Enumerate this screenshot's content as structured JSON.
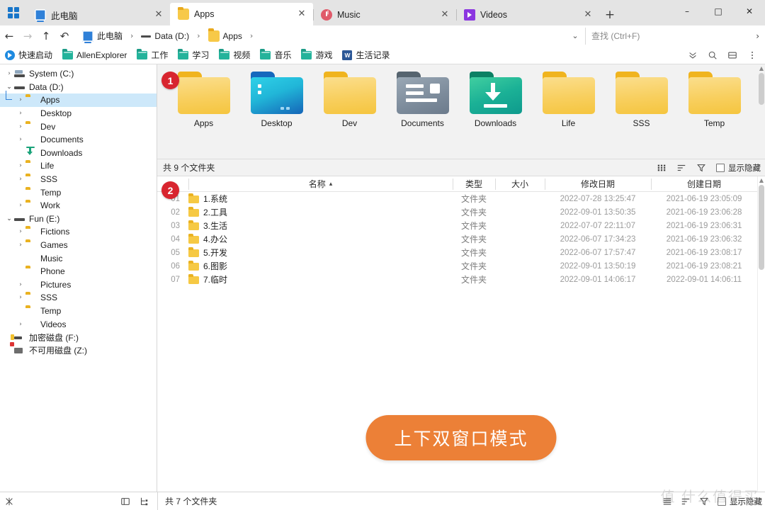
{
  "window": {
    "app_menu_icon": "grid-apps-icon",
    "minimize_label": "–",
    "maximize_label": "□",
    "close_label": "✕",
    "new_tab_label": "+"
  },
  "tabs": [
    {
      "label": "此电脑",
      "icon": "monitor-icon",
      "active": false,
      "close": "✕"
    },
    {
      "label": "Apps",
      "icon": "folder-icon",
      "active": true,
      "close": "✕"
    },
    {
      "label": "Music",
      "icon": "music-icon",
      "active": false,
      "close": "✕"
    },
    {
      "label": "Videos",
      "icon": "video-icon",
      "active": false,
      "close": "✕"
    }
  ],
  "address": {
    "back": "←",
    "forward": "→",
    "up": "↑",
    "undo": "↶",
    "crumbs": [
      {
        "label": "此电脑",
        "icon": "monitor-icon",
        "sep": "›"
      },
      {
        "label": "Data (D:)",
        "icon": "drive-icon",
        "sep": "›"
      },
      {
        "label": "Apps",
        "icon": "folder-icon",
        "sep": "›"
      }
    ],
    "dropdown": "⌄",
    "search_placeholder": "查找 (Ctrl+F)",
    "search_value": "",
    "search_arrow": "›"
  },
  "bookmarks": {
    "items": [
      {
        "label": "快速启动",
        "icon": "quick-launch-icon"
      },
      {
        "label": "AllenExplorer",
        "icon": "teal-folder-icon"
      },
      {
        "label": "工作",
        "icon": "teal-folder-icon"
      },
      {
        "label": "学习",
        "icon": "teal-folder-icon"
      },
      {
        "label": "视频",
        "icon": "teal-folder-icon"
      },
      {
        "label": "音乐",
        "icon": "teal-folder-icon"
      },
      {
        "label": "游戏",
        "icon": "teal-folder-icon"
      },
      {
        "label": "生活记录",
        "icon": "word-doc-icon"
      }
    ],
    "tools": [
      "chevrons-down-icon",
      "search-icon",
      "split-view-icon",
      "more-vertical-icon"
    ]
  },
  "sidebar": {
    "items": [
      {
        "label": "System (C:)",
        "icon": "drive-system-icon",
        "chev": "›",
        "indent": 0,
        "selected": false
      },
      {
        "label": "Data (D:)",
        "icon": "drive-icon",
        "chev": "⌄",
        "indent": 0,
        "selected": false
      },
      {
        "label": "Apps",
        "icon": "folder-icon",
        "chev": "›",
        "indent": 1,
        "selected": true
      },
      {
        "label": "Desktop",
        "icon": "desktop-icon",
        "chev": "›",
        "indent": 1,
        "selected": false
      },
      {
        "label": "Dev",
        "icon": "folder-icon",
        "chev": "›",
        "indent": 1,
        "selected": false
      },
      {
        "label": "Documents",
        "icon": "documents-icon",
        "chev": "›",
        "indent": 1,
        "selected": false
      },
      {
        "label": "Downloads",
        "icon": "downloads-icon",
        "chev": "",
        "indent": 1,
        "selected": false
      },
      {
        "label": "Life",
        "icon": "folder-icon",
        "chev": "›",
        "indent": 1,
        "selected": false
      },
      {
        "label": "SSS",
        "icon": "folder-icon",
        "chev": "›",
        "indent": 1,
        "selected": false
      },
      {
        "label": "Temp",
        "icon": "folder-icon",
        "chev": "",
        "indent": 1,
        "selected": false
      },
      {
        "label": "Work",
        "icon": "folder-icon",
        "chev": "›",
        "indent": 1,
        "selected": false
      },
      {
        "label": "Fun (E:)",
        "icon": "drive-icon",
        "chev": "⌄",
        "indent": 0,
        "selected": false
      },
      {
        "label": "Fictions",
        "icon": "folder-icon",
        "chev": "›",
        "indent": 1,
        "selected": false
      },
      {
        "label": "Games",
        "icon": "folder-icon",
        "chev": "›",
        "indent": 1,
        "selected": false
      },
      {
        "label": "Music",
        "icon": "music-icon",
        "chev": "",
        "indent": 1,
        "selected": false
      },
      {
        "label": "Phone",
        "icon": "folder-icon",
        "chev": "",
        "indent": 1,
        "selected": false
      },
      {
        "label": "Pictures",
        "icon": "pictures-icon",
        "chev": "›",
        "indent": 1,
        "selected": false
      },
      {
        "label": "SSS",
        "icon": "folder-icon",
        "chev": "›",
        "indent": 1,
        "selected": false
      },
      {
        "label": "Temp",
        "icon": "folder-icon",
        "chev": "",
        "indent": 1,
        "selected": false
      },
      {
        "label": "Videos",
        "icon": "video-icon",
        "chev": "›",
        "indent": 1,
        "selected": false
      },
      {
        "label": "加密磁盘 (F:)",
        "icon": "encrypted-drive-icon",
        "chev": "",
        "indent": 0,
        "selected": false
      },
      {
        "label": "不可用磁盘 (Z:)",
        "icon": "unavailable-drive-icon",
        "chev": "",
        "indent": 0,
        "selected": false
      }
    ]
  },
  "top_pane": {
    "badge": "1",
    "folders": [
      {
        "label": "Apps",
        "style": "yellow",
        "icon": "folder-icon"
      },
      {
        "label": "Desktop",
        "style": "blue",
        "icon": "desktop-folder-icon"
      },
      {
        "label": "Dev",
        "style": "yellow",
        "icon": "folder-icon"
      },
      {
        "label": "Documents",
        "style": "gray",
        "icon": "documents-folder-icon"
      },
      {
        "label": "Downloads",
        "style": "green",
        "icon": "downloads-folder-icon"
      },
      {
        "label": "Life",
        "style": "yellow",
        "icon": "folder-icon"
      },
      {
        "label": "SSS",
        "style": "yellow",
        "icon": "folder-icon"
      },
      {
        "label": "Temp",
        "style": "yellow",
        "icon": "folder-icon"
      }
    ],
    "status": "共 9 个文件夹",
    "tools": [
      "grid-view-icon",
      "sort-icon",
      "filter-icon"
    ],
    "show_hidden_label": "显示隐藏",
    "show_hidden_checked": false
  },
  "bottom_pane": {
    "badge": "2",
    "columns": {
      "index": "",
      "name": "名称",
      "name_sort": "▴",
      "type": "类型",
      "size": "大小",
      "modified": "修改日期",
      "created": "创建日期"
    },
    "rows": [
      {
        "idx": "01",
        "name": "1.系统",
        "type": "文件夹",
        "size": "",
        "modified": "2022-07-28  13:25:47",
        "created": "2021-06-19  23:05:09"
      },
      {
        "idx": "02",
        "name": "2.工具",
        "type": "文件夹",
        "size": "",
        "modified": "2022-09-01  13:50:35",
        "created": "2021-06-19  23:06:28"
      },
      {
        "idx": "03",
        "name": "3.生活",
        "type": "文件夹",
        "size": "",
        "modified": "2022-07-07  22:11:07",
        "created": "2021-06-19  23:06:31"
      },
      {
        "idx": "04",
        "name": "4.办公",
        "type": "文件夹",
        "size": "",
        "modified": "2022-06-07  17:34:23",
        "created": "2021-06-19  23:06:32"
      },
      {
        "idx": "05",
        "name": "5.开发",
        "type": "文件夹",
        "size": "",
        "modified": "2022-06-07  17:57:47",
        "created": "2021-06-19  23:08:17"
      },
      {
        "idx": "06",
        "name": "6.图影",
        "type": "文件夹",
        "size": "",
        "modified": "2022-09-01  13:50:19",
        "created": "2021-06-19  23:08:21"
      },
      {
        "idx": "07",
        "name": "7.临时",
        "type": "文件夹",
        "size": "",
        "modified": "2022-09-01  14:06:17",
        "created": "2022-09-01  14:06:11"
      }
    ],
    "cta_label": "上下双窗口模式",
    "cta_color": "#ec8037"
  },
  "bottom_bar": {
    "left_icon": "pin-icon",
    "left_tools": [
      "indent-icon",
      "tree-icon"
    ],
    "status": "共 7 个文件夹",
    "right_tools": [
      "list-view-icon",
      "sort-icon",
      "filter-icon"
    ],
    "show_hidden_label": "显示隐藏",
    "show_hidden_checked": false
  },
  "watermark": "值 什么值得买"
}
